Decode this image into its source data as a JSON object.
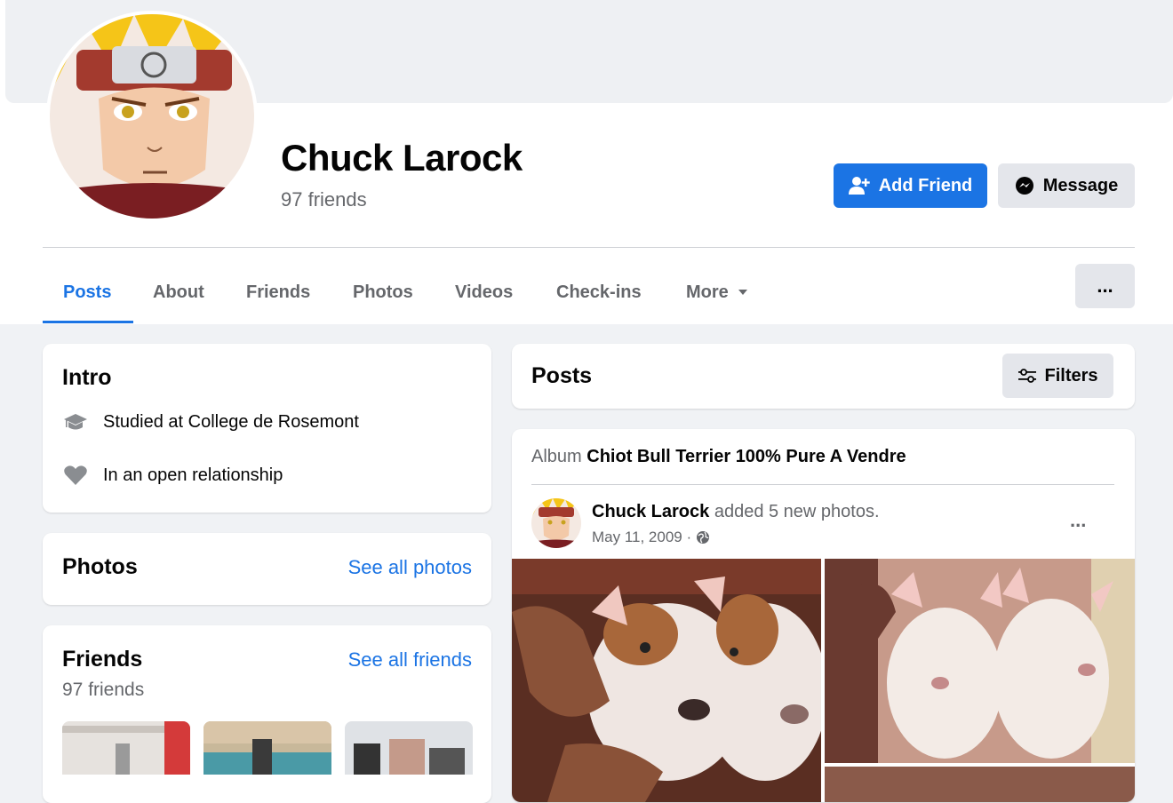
{
  "profile": {
    "name": "Chuck Larock",
    "friends_count": "97 friends"
  },
  "actions": {
    "add_friend": "Add Friend",
    "message": "Message",
    "more": "..."
  },
  "tabs": [
    {
      "label": "Posts",
      "active": true
    },
    {
      "label": "About"
    },
    {
      "label": "Friends"
    },
    {
      "label": "Photos"
    },
    {
      "label": "Videos"
    },
    {
      "label": "Check-ins"
    },
    {
      "label": "More"
    }
  ],
  "intro": {
    "title": "Intro",
    "items": [
      {
        "icon": "graduation-cap-icon",
        "text": "Studied at College de Rosemont"
      },
      {
        "icon": "heart-icon",
        "text": "In an open relationship"
      }
    ]
  },
  "photos_card": {
    "title": "Photos",
    "link": "See all photos"
  },
  "friends_card": {
    "title": "Friends",
    "link": "See all friends",
    "count": "97 friends"
  },
  "posts_header": {
    "title": "Posts",
    "filters": "Filters"
  },
  "post": {
    "album_prefix": "Album",
    "album_name": "Chiot Bull Terrier 100% Pure A Vendre",
    "author": "Chuck Larock",
    "action": "added 5 new photos.",
    "date": "May 11, 2009 ·",
    "privacy_icon": "globe-icon",
    "menu": "..."
  },
  "colors": {
    "accent": "#1b74e4",
    "background": "#f0f2f5",
    "secondary_text": "#65676b"
  }
}
